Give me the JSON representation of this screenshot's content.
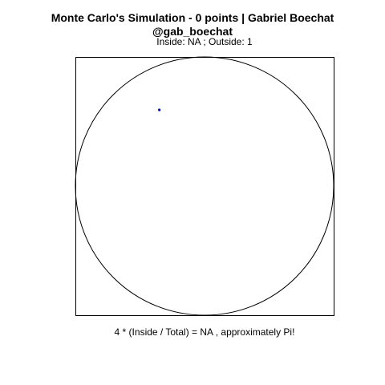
{
  "chart_data": {
    "type": "scatter",
    "title_lines": [
      "Monte Carlo's Simulation - 0 points | Gabriel Boechat",
      "@gab_boechat"
    ],
    "subtitle": "Inside: NA ;  Outside: 1",
    "footer": "4 * (Inside / Total) =  NA , approximately Pi!",
    "xlim": [
      -1,
      1
    ],
    "ylim": [
      -1,
      1
    ],
    "shapes": {
      "square": {
        "x": [
          -1,
          1
        ],
        "y": [
          -1,
          1
        ],
        "color": "#000000"
      },
      "circle": {
        "cx": 0,
        "cy": 0,
        "r": 1,
        "color": "#000000"
      }
    },
    "series": [
      {
        "points": [
          {
            "x": -0.35,
            "y": 0.59
          }
        ],
        "color": "#0000cc"
      }
    ],
    "axes_visible": false,
    "grid": false
  }
}
